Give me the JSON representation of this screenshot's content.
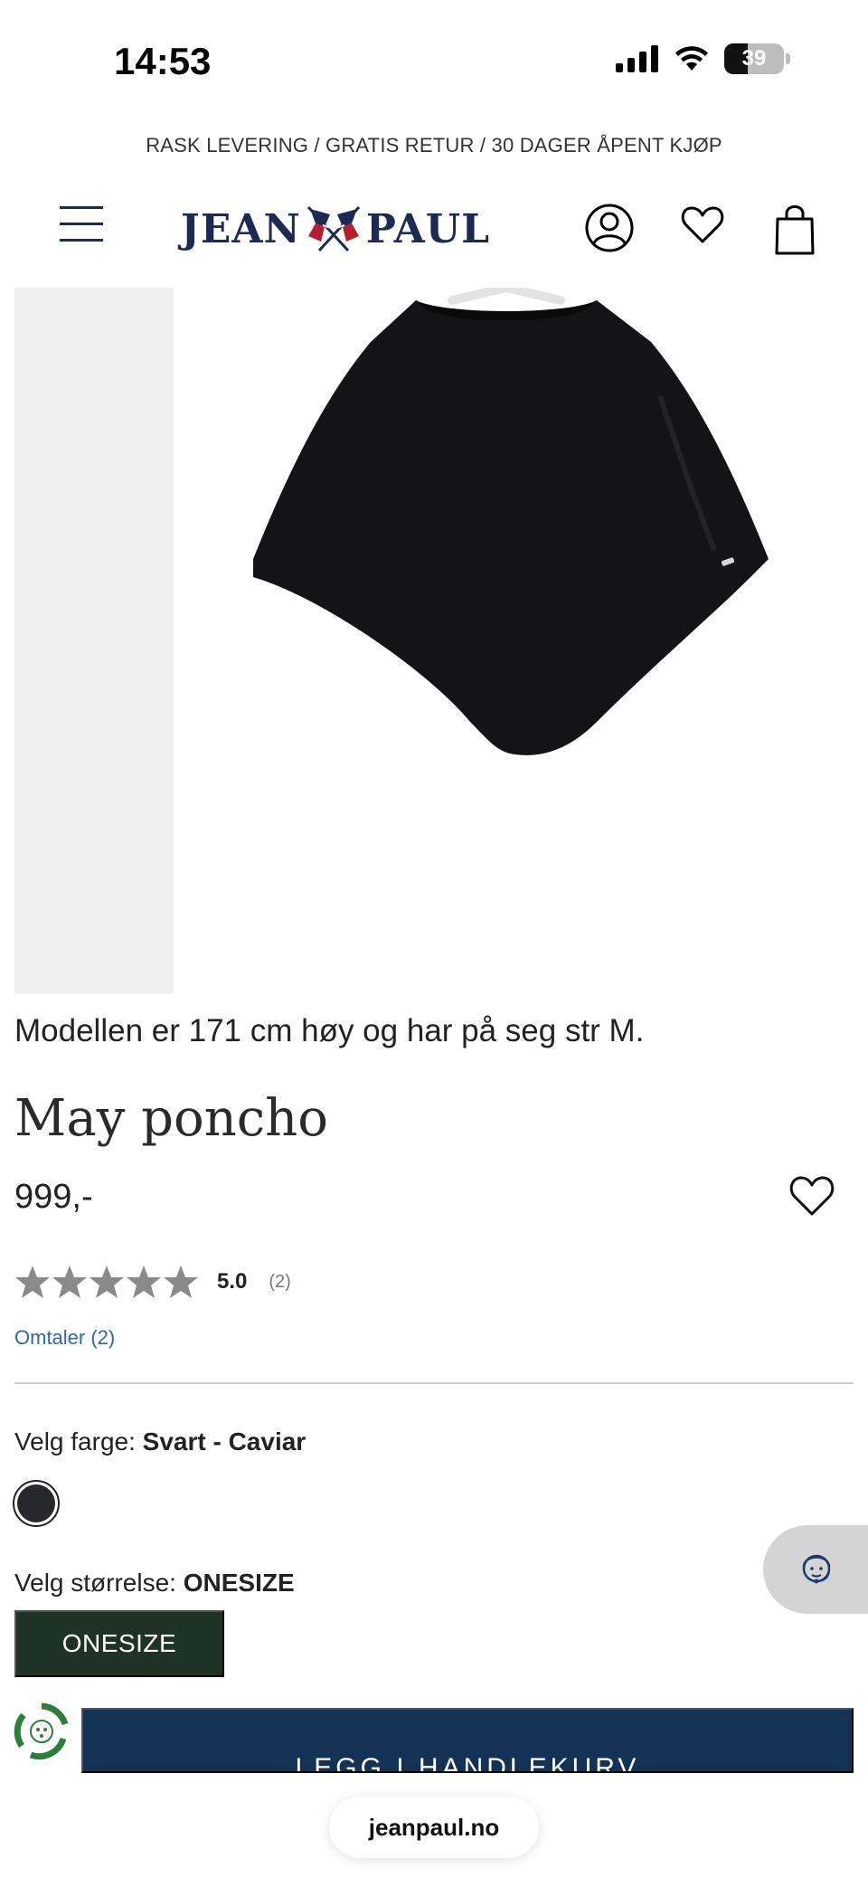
{
  "status_bar": {
    "time": "14:53",
    "battery": "39",
    "icons": [
      "cellular-signal-icon",
      "wifi-icon",
      "battery-icon"
    ]
  },
  "promo": {
    "text": "RASK LEVERING / GRATIS RETUR / 30 DAGER ÅPENT KJØP"
  },
  "header": {
    "logo_left": "JEAN",
    "logo_right": "PAUL",
    "icons": [
      "menu-icon",
      "account-icon",
      "heart-icon",
      "shopping-bag-icon"
    ]
  },
  "product": {
    "model_info": "Modellen er 171 cm høy og har på seg str M.",
    "title": "May poncho",
    "price": "999,-",
    "rating_value": 5.0,
    "rating_score": "5.0",
    "rating_count": "(2)",
    "reviews_link": "Omtaler (2)",
    "color_label": "Velg farge: ",
    "color_value": "Svart - Caviar",
    "swatch_color": "#26282d",
    "size_label": "Velg størrelse: ",
    "size_value": "ONESIZE",
    "size_option": "ONESIZE",
    "add_to_cart": "LEGG I HANDLEKURV"
  },
  "colors": {
    "brand_navy": "#1d2b53",
    "cart_button": "#143156",
    "size_button": "#1f3324",
    "link": "#2c6aa0",
    "star": "#8a8a8a"
  },
  "browser": {
    "url": "jeanpaul.no"
  }
}
